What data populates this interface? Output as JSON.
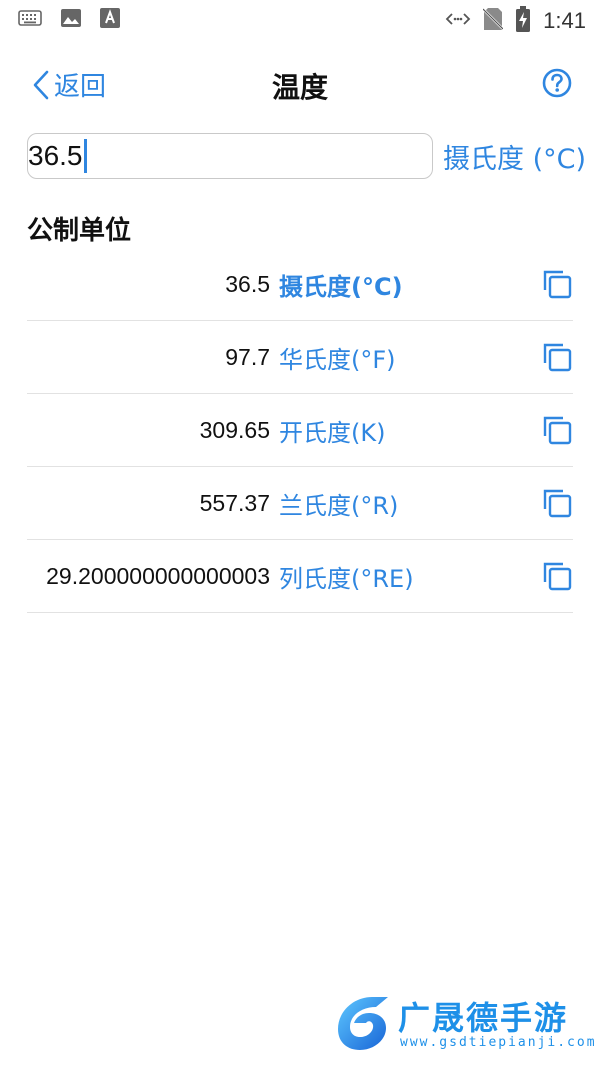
{
  "status_bar": {
    "time": "1:41",
    "left_icons": [
      "keyboard-icon",
      "image-icon",
      "font-icon"
    ],
    "right_icons": [
      "data-arrows-icon",
      "no-sim-icon",
      "battery-charging-icon"
    ]
  },
  "nav": {
    "back_label": "返回",
    "title": "温度",
    "help_icon": "help-circle-icon"
  },
  "input": {
    "value": "36.5",
    "unit": "摄氏度 (°C)"
  },
  "section": {
    "title": "公制单位"
  },
  "results": [
    {
      "value": "36.5",
      "unit": "摄氏度(°C)",
      "selected": true
    },
    {
      "value": "97.7",
      "unit": "华氏度(°F)",
      "selected": false
    },
    {
      "value": "309.65",
      "unit": "开氏度(K)",
      "selected": false
    },
    {
      "value": "557.37",
      "unit": "兰氏度(°R)",
      "selected": false
    },
    {
      "value": "29.200000000000003",
      "unit": "列氏度(°RE)",
      "selected": false
    }
  ],
  "watermark": {
    "title": "广晟德手游",
    "url": "www.gsdtiepianji.com"
  },
  "colors": {
    "accent": "#2f86e0",
    "divider": "#e2e2e2",
    "watermark": "#1e90e8"
  }
}
